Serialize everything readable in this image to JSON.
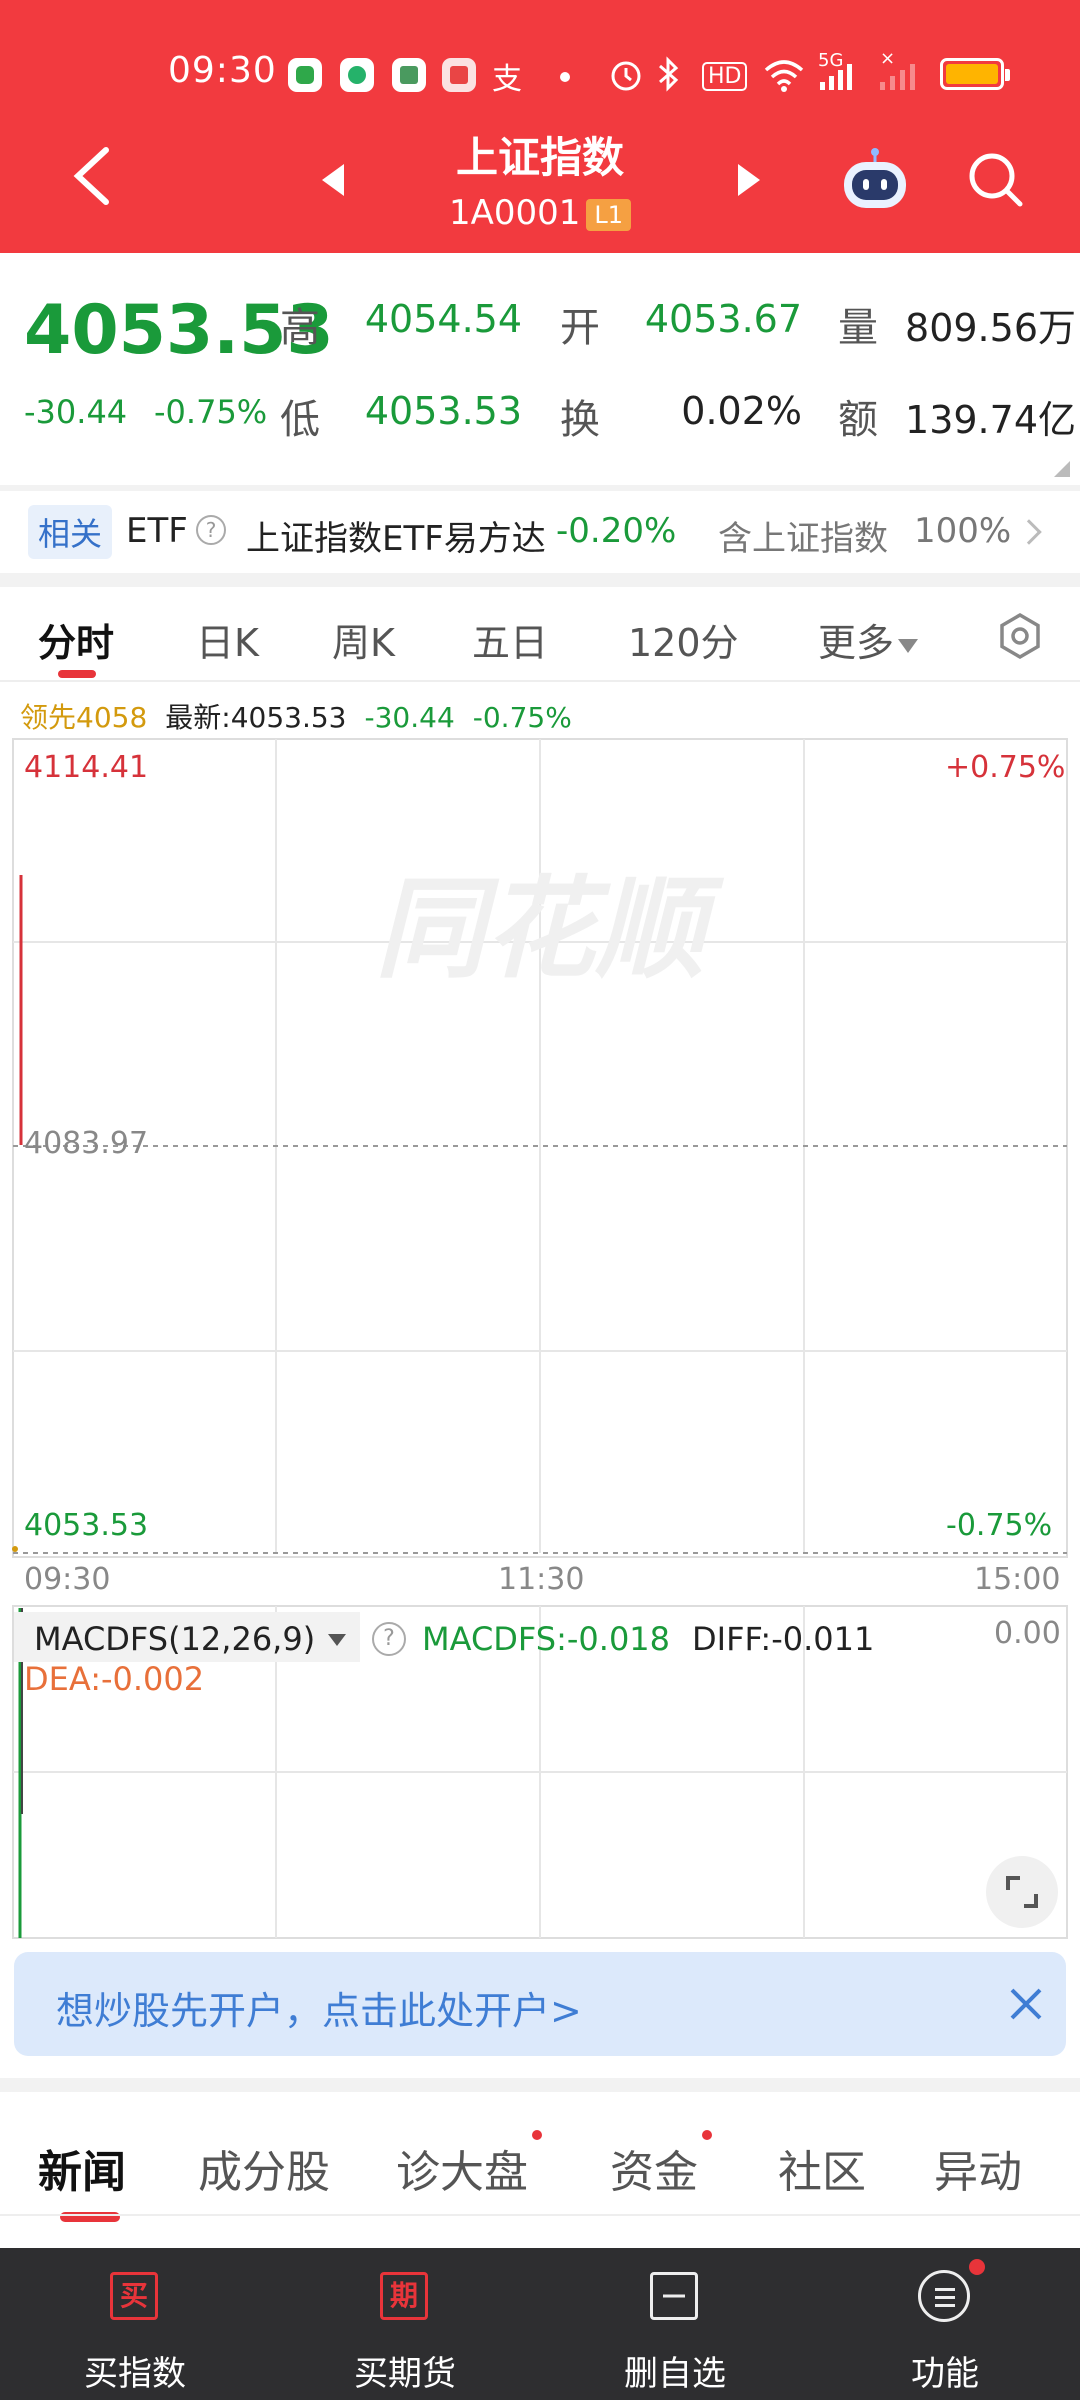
{
  "status_bar": {
    "time": "09:30",
    "glyph_a": "支",
    "glyph_b": "HD",
    "glyph_c": "5G",
    "glyph_d": "×"
  },
  "header": {
    "title": "上证指数",
    "code": "1A0001",
    "level_badge": "L1"
  },
  "quote": {
    "price": "4053.53",
    "change": "-30.44",
    "change_pct": "-0.75%",
    "high_label": "高",
    "high": "4054.54",
    "open_label": "开",
    "open": "4053.67",
    "volume_label": "量",
    "volume": "809.56万",
    "low_label": "低",
    "low": "4053.53",
    "turnover_label": "换",
    "turnover": "0.02%",
    "amount_label": "额",
    "amount": "139.74亿"
  },
  "etf": {
    "badge": "相关",
    "label": "ETF",
    "help": "?",
    "name": "上证指数ETF易方达",
    "change": "-0.20%",
    "weight_label": "含上证指数",
    "weight": "100%"
  },
  "chart_tabs": {
    "tab1": "分时",
    "tab2": "日K",
    "tab3": "周K",
    "tab4": "五日",
    "tab5": "120分",
    "tab6": "更多"
  },
  "info_line": {
    "leader": "领先4058",
    "latest": "最新:4053.53",
    "change": "-30.44",
    "change_pct": "-0.75%"
  },
  "chart_data": {
    "type": "line",
    "y_top_label": "4114.41",
    "y_mid_label": "4083.97",
    "y_bottom_label": "4053.53",
    "pct_top_label": "+0.75%",
    "pct_bottom_label": "-0.75%",
    "ylim": [
      4053.53,
      4114.41
    ],
    "prev_close": 4083.97,
    "x_labels": [
      "09:30",
      "11:30",
      "15:00"
    ],
    "watermark": "同花顺",
    "series": [
      {
        "x": [
          "09:30"
        ],
        "values": [
          4053.53
        ]
      }
    ]
  },
  "macd": {
    "name": "MACDFS(12,26,9)",
    "help": "?",
    "macdfs": "MACDFS:-0.018",
    "diff": "DIFF:-0.011",
    "dea": "DEA:-0.002",
    "right_value": "0.00"
  },
  "banner": {
    "text": "想炒股先开户，点击此处开户>"
  },
  "bottom_tabs": {
    "tab1": "新闻",
    "tab2": "成分股",
    "tab3": "诊大盘",
    "tab4": "资金",
    "tab5": "社区",
    "tab6": "异动"
  },
  "nav": {
    "item1_icon": "买",
    "item1": "买指数",
    "item2_icon": "期",
    "item2": "买期货",
    "item3": "删自选",
    "item4": "功能"
  },
  "colors": {
    "header_red": "#f23a3f",
    "down_green": "#1a9a3a",
    "up_red": "#d6323a",
    "leader_gold": "#d39a0e",
    "dea_orange": "#e8703a",
    "banner_blue": "#3f7dd4"
  }
}
